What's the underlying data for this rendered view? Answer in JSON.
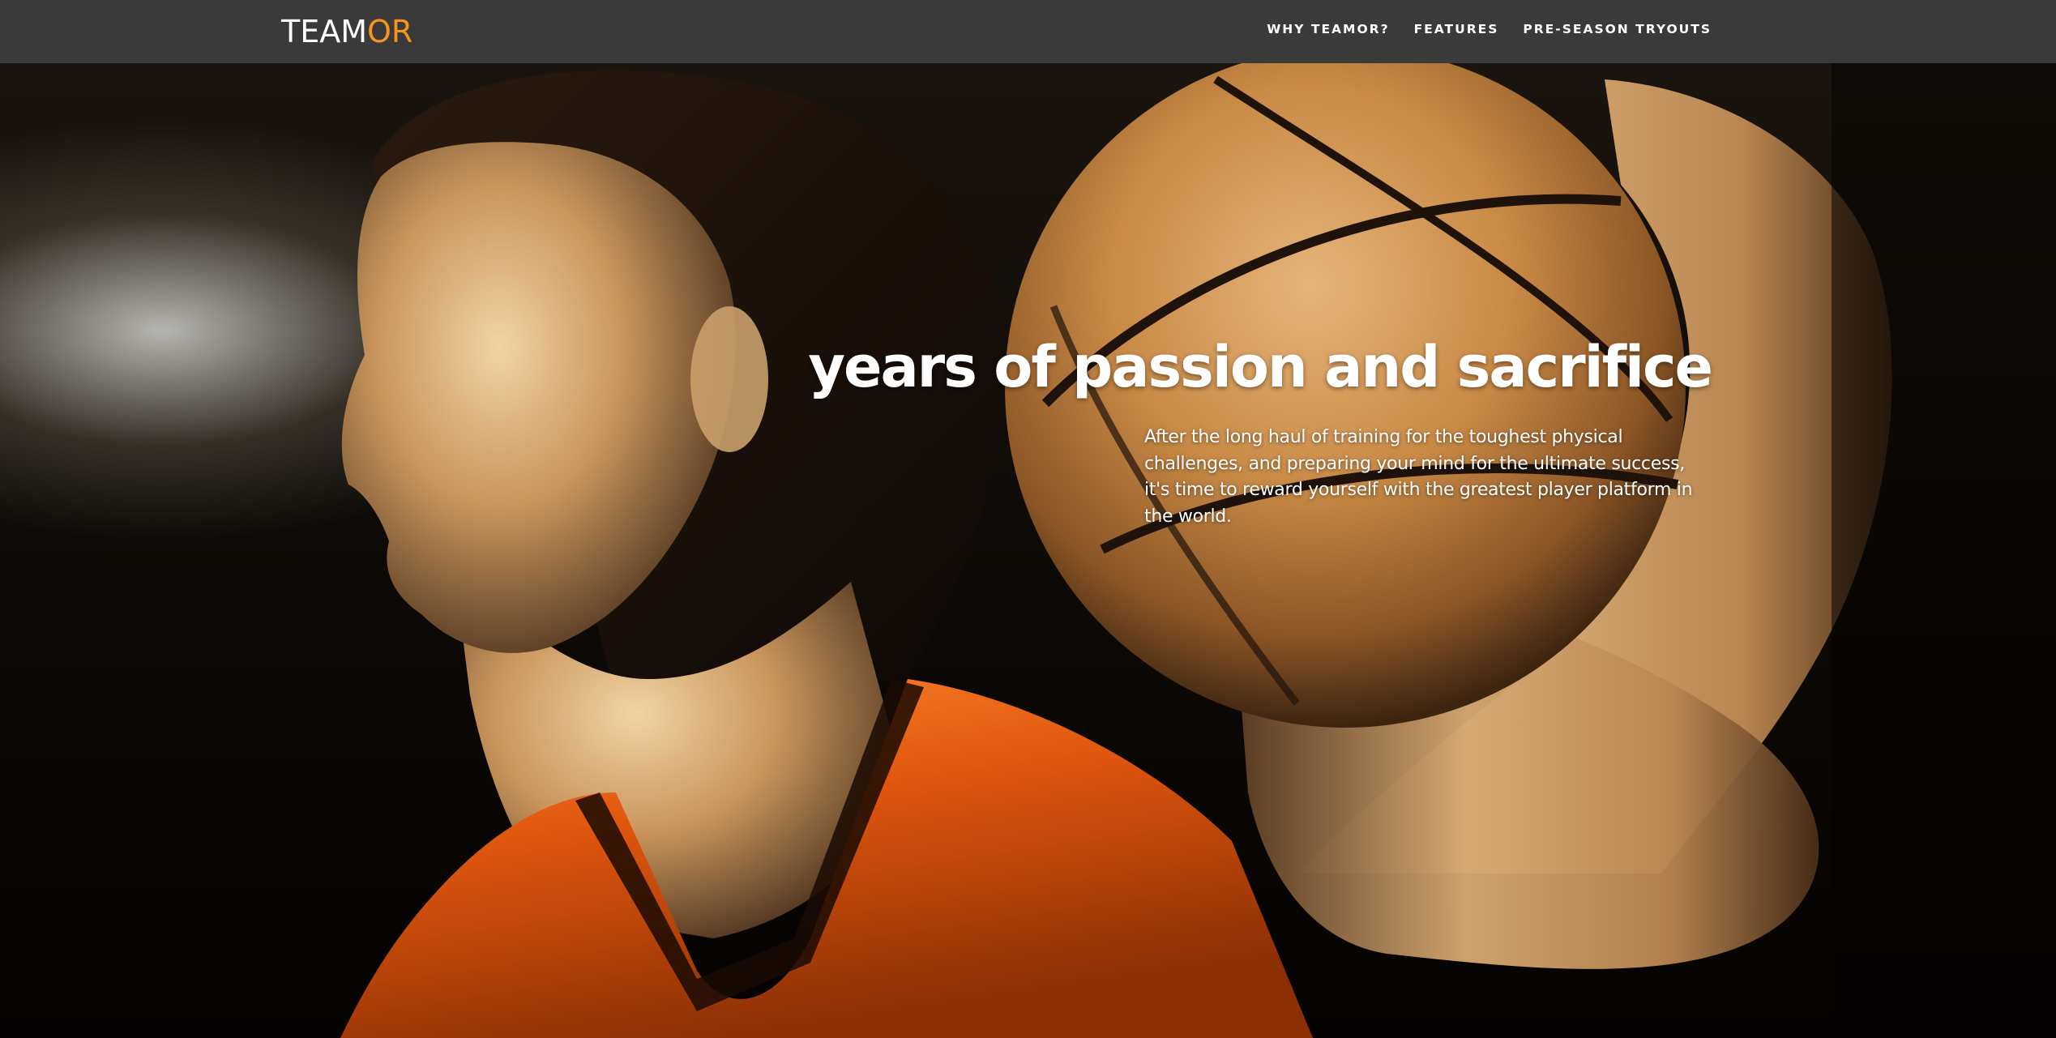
{
  "brand": {
    "logo_part1": "TEAM",
    "logo_part2": "OR",
    "accent_color": "#f7941d"
  },
  "nav": {
    "items": [
      {
        "label": "WHY TEAMOR?"
      },
      {
        "label": "FEATURES"
      },
      {
        "label": "PRE-SEASON TRYOUTS"
      }
    ]
  },
  "hero": {
    "image_subject": "basketball player in orange jersey holding a basketball on her shoulder",
    "headline": "years of passion and sacrifice",
    "body": "After the long haul of training for the toughest physical challenges, and preparing your mind for the ultimate success, it's time to reward yourself with the greatest player platform in the world."
  },
  "colors": {
    "navbar_bg": "#3a3a3a",
    "jersey_orange": "#e0560e",
    "ball_tan": "#c8823c"
  }
}
